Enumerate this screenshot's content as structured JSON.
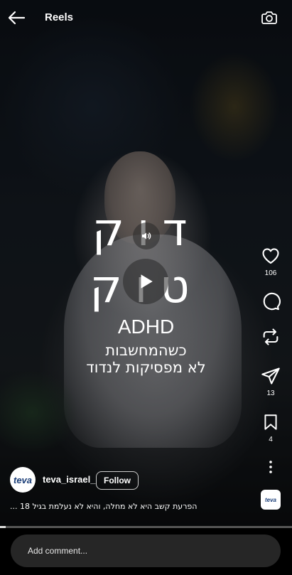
{
  "header": {
    "title": "Reels"
  },
  "video": {
    "title_line_1": "דוק",
    "title_line_2": "טוק",
    "headline": "ADHD",
    "subline_1": "כשהמחשבות",
    "subline_2": "לא מפסיקות לנדוד",
    "muted": false,
    "progress": 0.02
  },
  "actions": {
    "likes": "106",
    "shares": "13",
    "saves": "4"
  },
  "author": {
    "avatar_text": "teva",
    "username": "teva_israel_",
    "follow_label": "Follow"
  },
  "caption": "... הפרעת קשב היא לא מחלה, והיא לא נעלמת בגיל 18",
  "audio_thumb_text": "teva",
  "comment": {
    "placeholder": "Add comment..."
  },
  "colors": {
    "brand": "#1b3e78",
    "comment_bg": "#262626",
    "background": "#000000"
  },
  "icons": [
    "back-arrow-icon",
    "camera-icon",
    "sound-icon",
    "play-icon",
    "heart-icon",
    "comment-icon",
    "repost-icon",
    "send-icon",
    "bookmark-icon",
    "more-icon"
  ]
}
